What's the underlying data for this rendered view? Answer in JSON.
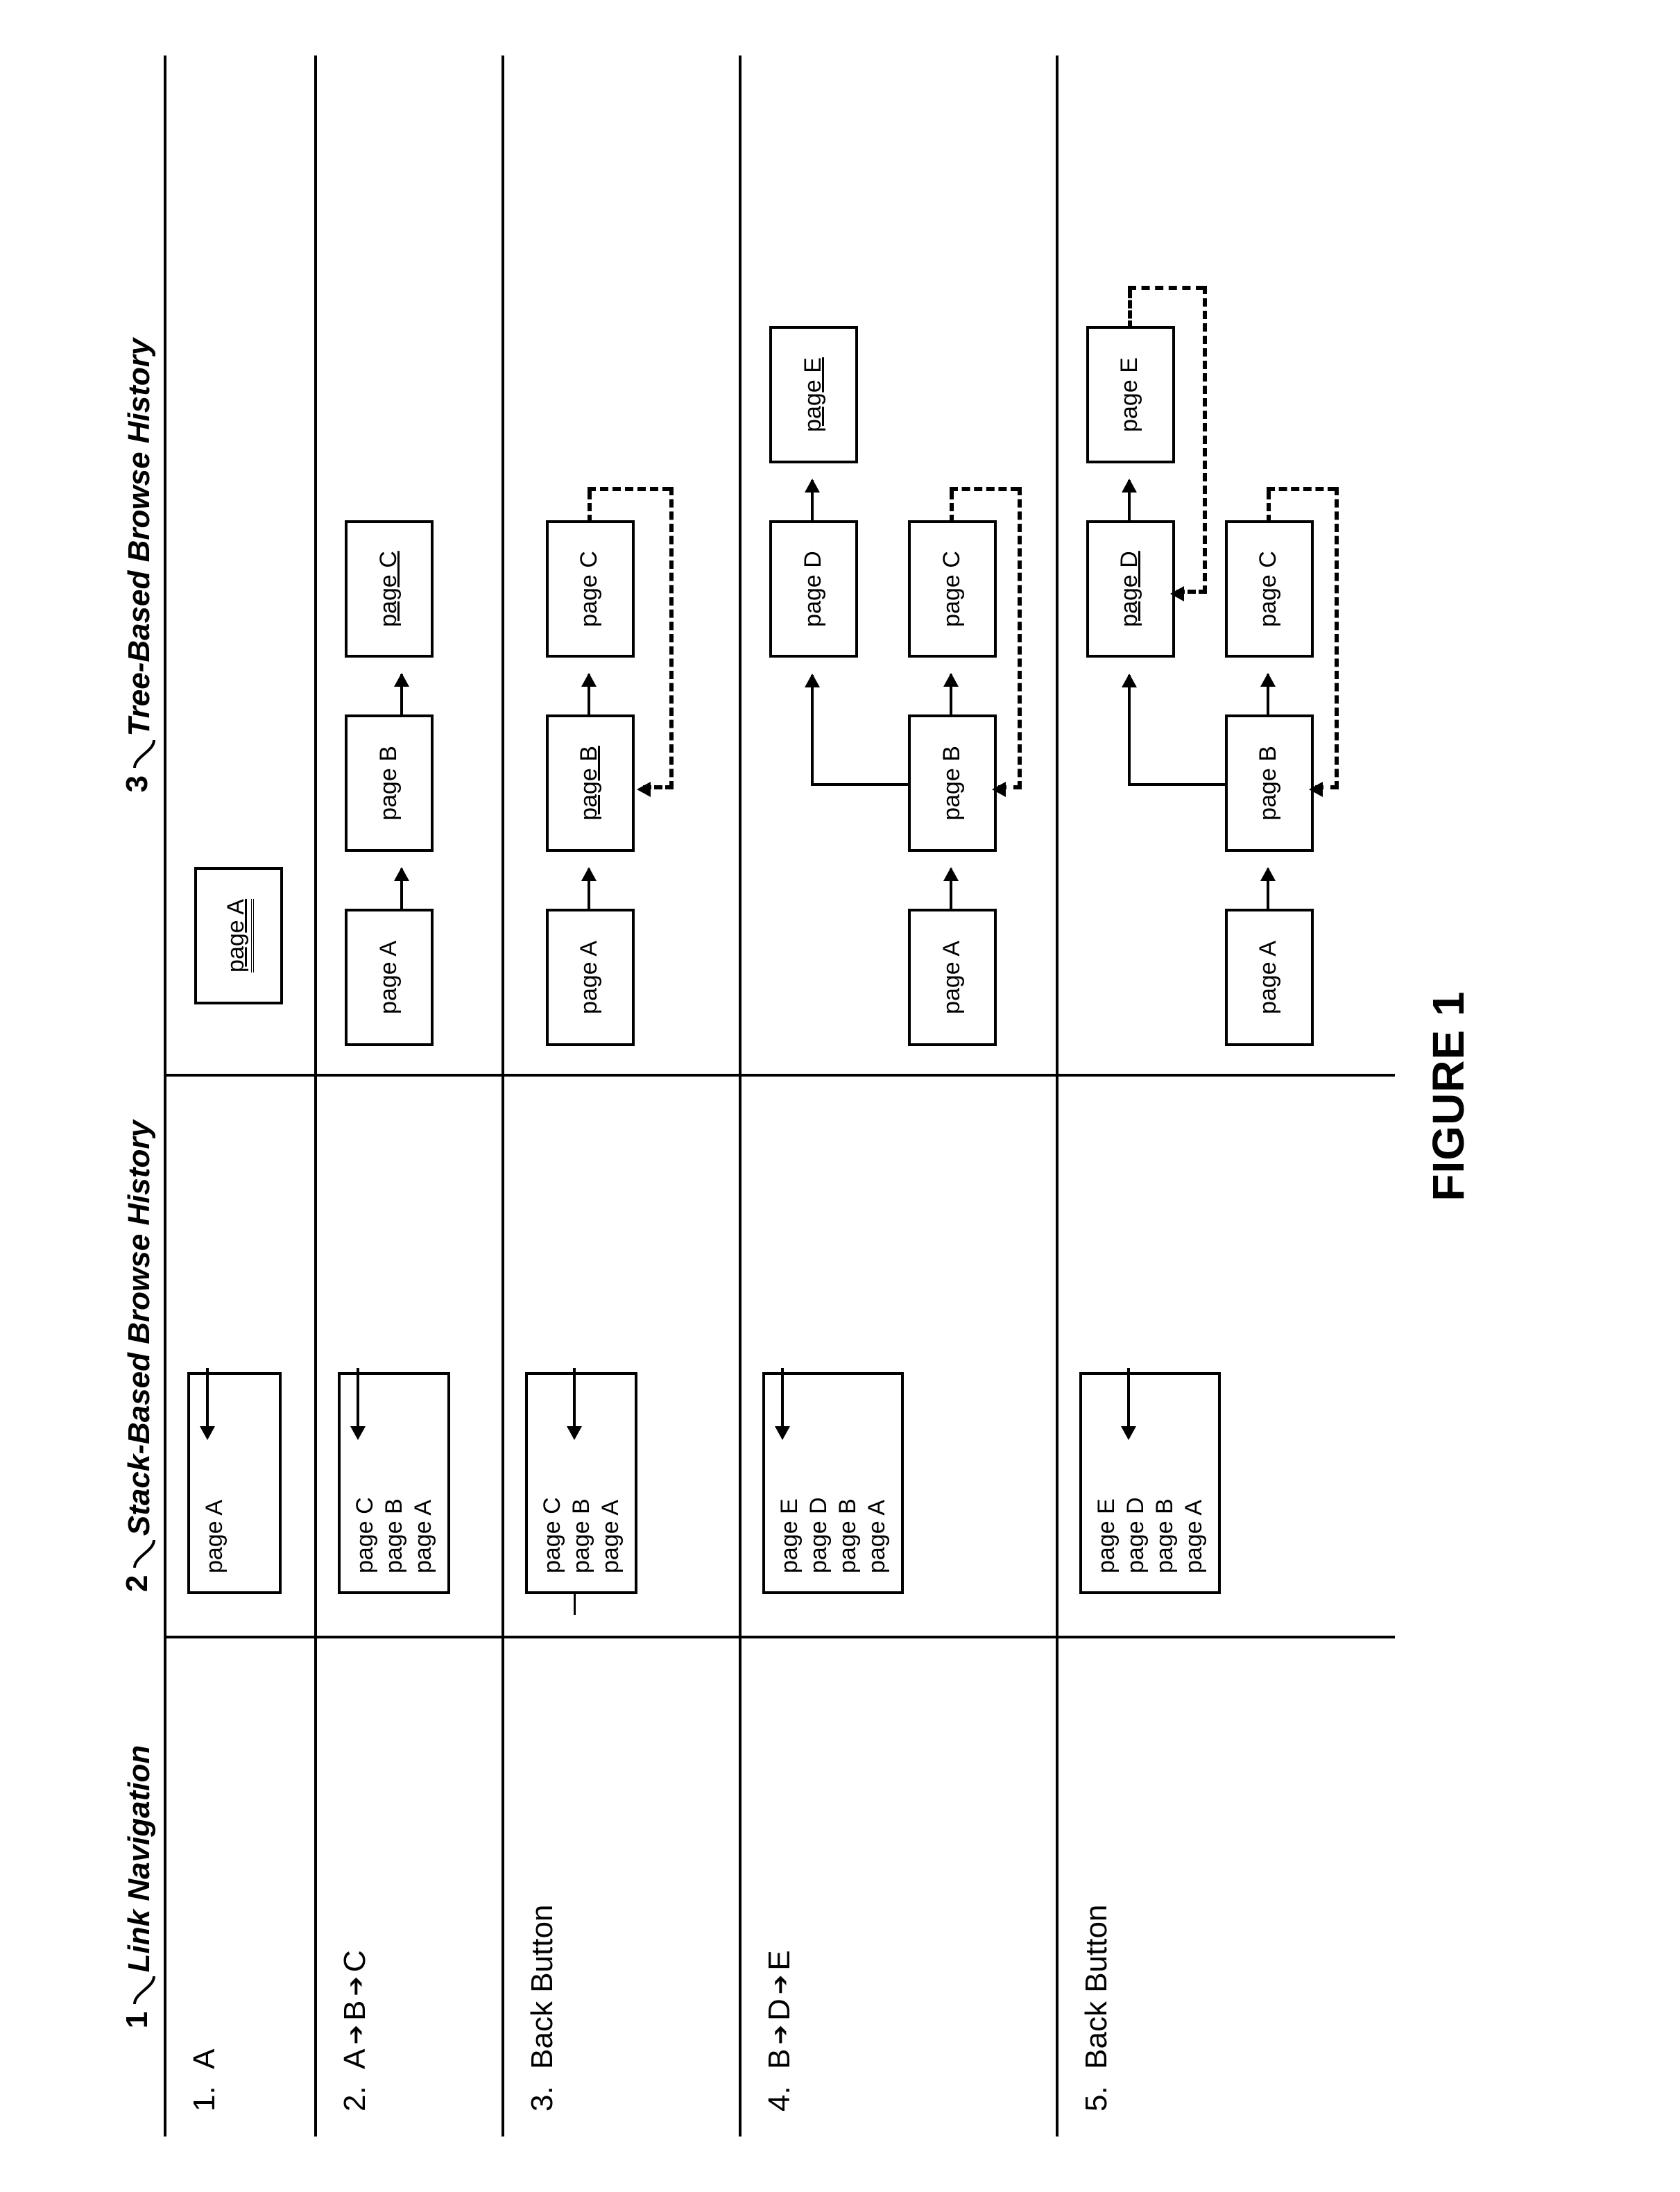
{
  "figure_caption": "FIGURE 1",
  "columns": {
    "col1": {
      "num": "1",
      "label": "Link Navigation"
    },
    "col2": {
      "num": "2",
      "label": "Stack-Based Browse History"
    },
    "col3": {
      "num": "3",
      "label": "Tree-Based Browse History"
    }
  },
  "rows": {
    "r1": {
      "num": "1.",
      "nav": "A"
    },
    "r2": {
      "num": "2.",
      "nav_parts": [
        "A",
        "B",
        "C"
      ]
    },
    "r3": {
      "num": "3.",
      "nav": "Back Button"
    },
    "r4": {
      "num": "4.",
      "nav_parts": [
        "B",
        "D",
        "E"
      ]
    },
    "r5": {
      "num": "5.",
      "nav": "Back Button"
    }
  },
  "stacks": {
    "r1": {
      "items": [
        "page A"
      ],
      "pointer": 0
    },
    "r2": {
      "items": [
        "page C",
        "page B",
        "page A"
      ],
      "pointer": 0
    },
    "r3": {
      "items": [
        "page C",
        "page B",
        "page A"
      ],
      "pointer": 1
    },
    "r4": {
      "items": [
        "page E",
        "page D",
        "page B",
        "page A"
      ],
      "pointer": 0
    },
    "r5": {
      "items": [
        "page E",
        "page D",
        "page B",
        "page A"
      ],
      "pointer": 1
    }
  },
  "tree_labels": {
    "A": "page A",
    "B": "page B",
    "C": "page C",
    "D": "page D",
    "E": "page E"
  }
}
